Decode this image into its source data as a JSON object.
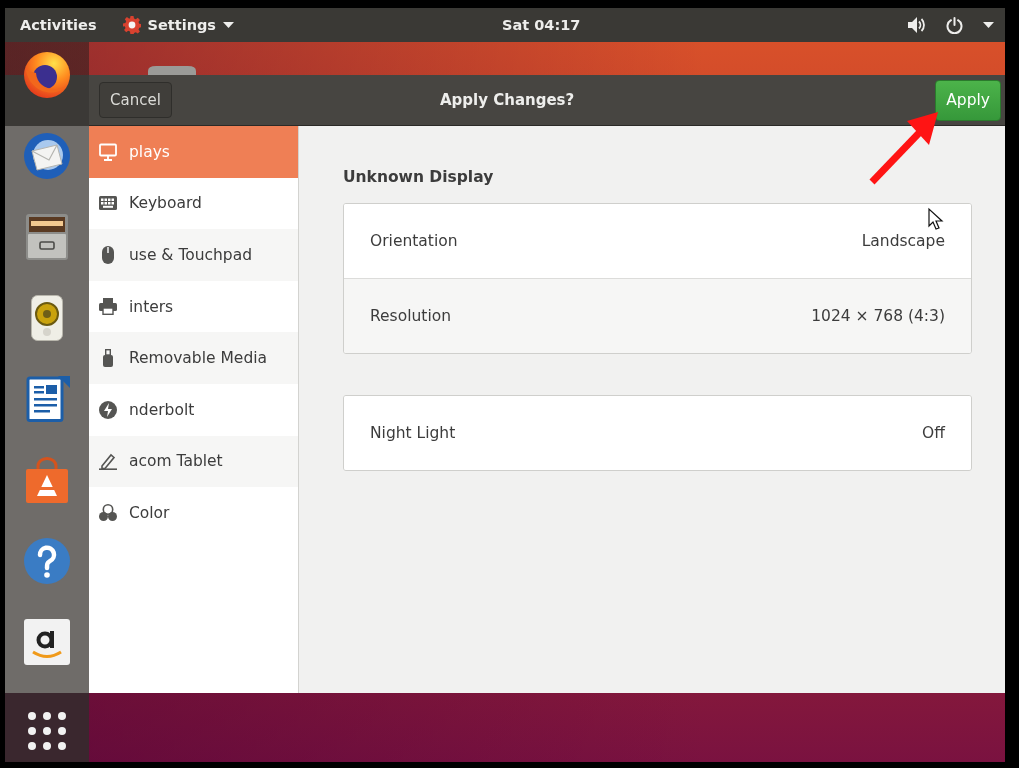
{
  "top_bar": {
    "activities": "Activities",
    "app_menu": "Settings",
    "clock": "Sat 04:17"
  },
  "header_bar": {
    "cancel": "Cancel",
    "title": "Apply Changes?",
    "apply": "Apply"
  },
  "sidebar": {
    "items": [
      {
        "label": "plays",
        "selected": true
      },
      {
        "label": "Keyboard",
        "selected": false
      },
      {
        "label": "use & Touchpad",
        "selected": false
      },
      {
        "label": "inters",
        "selected": false
      },
      {
        "label": "Removable Media",
        "selected": false
      },
      {
        "label": "nderbolt",
        "selected": false
      },
      {
        "label": "acom Tablet",
        "selected": false
      },
      {
        "label": "Color",
        "selected": false
      }
    ]
  },
  "display": {
    "heading": "Unknown Display",
    "rows": [
      {
        "label": "Orientation",
        "value": "Landscape"
      },
      {
        "label": "Resolution",
        "value": "1024 × 768 (4:3)"
      }
    ]
  },
  "night_light": {
    "label": "Night Light",
    "value": "Off"
  }
}
